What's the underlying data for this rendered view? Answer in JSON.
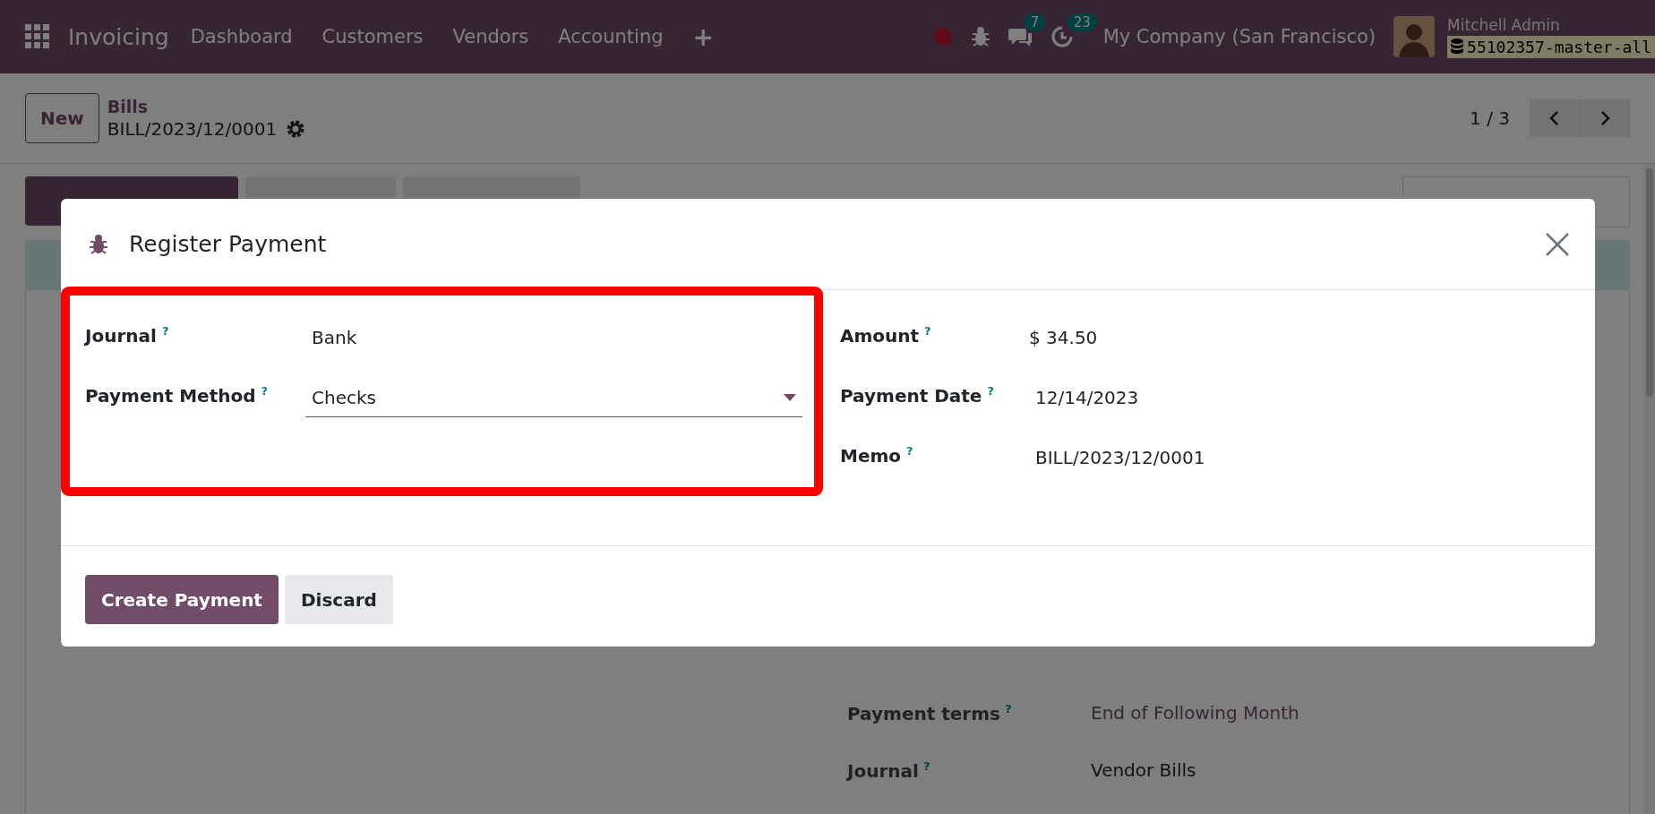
{
  "navbar": {
    "app_name": "Invoicing",
    "menu": [
      "Dashboard",
      "Customers",
      "Vendors",
      "Accounting",
      "+"
    ],
    "chat_count": "7",
    "activity_count": "23",
    "company": "My Company (San Francisco)",
    "user_name": "Mitchell Admin",
    "database": "55102357-master-all"
  },
  "control_panel": {
    "new_button": "New",
    "breadcrumb": "Bills",
    "record": "BILL/2023/12/0001",
    "pager": "1 / 3"
  },
  "form": {
    "fields": [
      {
        "label": "Payment terms",
        "help": "?",
        "value": "End of Following Month",
        "kind": "link"
      },
      {
        "label": "Journal",
        "help": "?",
        "value": "Vendor Bills",
        "kind": "text"
      }
    ]
  },
  "dialog": {
    "title": "Register Payment",
    "left_fields": [
      {
        "label": "Journal",
        "help": "?",
        "value": "Bank",
        "kind": "text"
      },
      {
        "label": "Payment Method",
        "help": "?",
        "value": "Checks",
        "kind": "select"
      }
    ],
    "right_fields": [
      {
        "label": "Amount",
        "help": "?",
        "value": "$ 34.50",
        "kind": "text"
      },
      {
        "label": "Payment Date",
        "help": "?",
        "value": "12/14/2023",
        "kind": "input"
      },
      {
        "label": "Memo",
        "help": "?",
        "value": "BILL/2023/12/0001",
        "kind": "input"
      }
    ],
    "buttons": [
      {
        "label": "Create Payment",
        "primary": true
      },
      {
        "label": "Discard",
        "primary": false
      }
    ]
  }
}
